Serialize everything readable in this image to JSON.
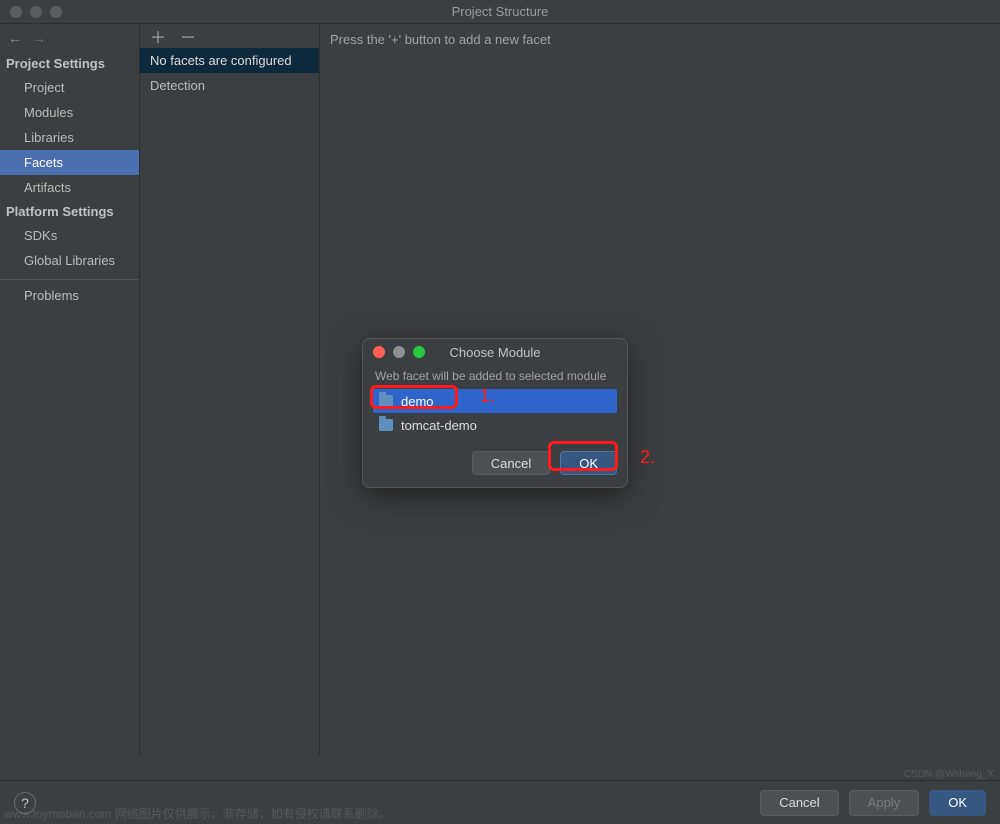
{
  "window": {
    "title": "Project Structure"
  },
  "sidebar": {
    "projectSettingsHeader": "Project Settings",
    "platformSettingsHeader": "Platform Settings",
    "items": {
      "project": "Project",
      "modules": "Modules",
      "libraries": "Libraries",
      "facets": "Facets",
      "artifacts": "Artifacts",
      "sdks": "SDKs",
      "globalLibraries": "Global Libraries",
      "problems": "Problems"
    }
  },
  "facets": {
    "noneConfigured": "No facets are configured",
    "detection": "Detection"
  },
  "main": {
    "hint": "Press the '+' button to add a new facet"
  },
  "footer": {
    "help": "?",
    "cancel": "Cancel",
    "apply": "Apply",
    "ok": "OK"
  },
  "dialog": {
    "title": "Choose Module",
    "hint": "Web facet will be added to selected module",
    "modules": [
      "demo",
      "tomcat-demo"
    ],
    "cancel": "Cancel",
    "ok": "OK"
  },
  "annotations": {
    "one": "1.",
    "two": "2."
  },
  "watermark": "www.toymoban.com 网络图片仅供展示，非存储，如有侵权请联系删除。",
  "watermark2": "CSDN @Wsheng_X"
}
